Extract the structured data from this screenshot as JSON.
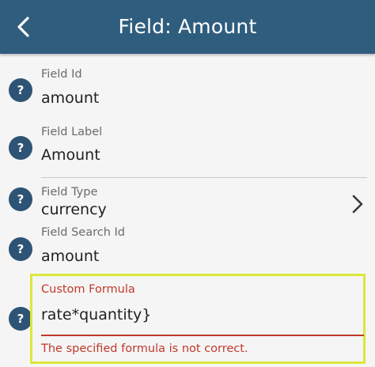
{
  "header": {
    "title": "Field: Amount",
    "back_icon": "chevron-left-icon",
    "background_color": "#2f5d7e"
  },
  "fields": [
    {
      "label": "Field Id",
      "value": "amount"
    },
    {
      "label": "Field Label",
      "value": "Amount"
    },
    {
      "label": "Field Type",
      "value": "currency"
    },
    {
      "label": "Field Search Id",
      "value": "amount"
    }
  ],
  "formula": {
    "label": "Custom Formula",
    "value": "rate*quantity}",
    "error": "The specified formula is not correct.",
    "error_color": "#c0392b",
    "highlight_color": "#dbe83a"
  },
  "help": {
    "glyph": "?",
    "icon": "help-icon"
  }
}
